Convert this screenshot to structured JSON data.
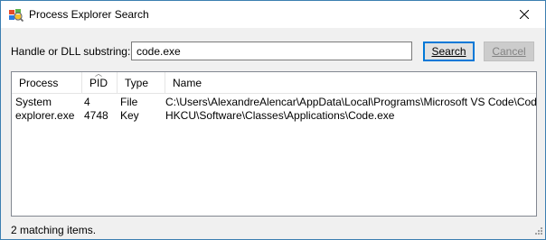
{
  "window": {
    "title": "Process Explorer Search",
    "app_icon": "process-explorer-icon",
    "close_icon": "close-icon"
  },
  "search": {
    "label": "Handle or DLL substring:",
    "value": "code.exe",
    "search_button": "Search",
    "cancel_button": "Cancel"
  },
  "results": {
    "columns": [
      "Process",
      "PID",
      "Type",
      "Name"
    ],
    "sort_column": "PID",
    "rows": [
      {
        "process": "System",
        "pid": "4",
        "type": "File",
        "name": "C:\\Users\\AlexandreAlencar\\AppData\\Local\\Programs\\Microsoft VS Code\\Code.exe"
      },
      {
        "process": "explorer.exe",
        "pid": "4748",
        "type": "Key",
        "name": "HKCU\\Software\\Classes\\Applications\\Code.exe"
      }
    ]
  },
  "status": {
    "text": "2 matching items."
  },
  "colors": {
    "window_border": "#3c7fb1",
    "button_focus": "#0078d7",
    "dialog_bg": "#f0f0f0"
  }
}
